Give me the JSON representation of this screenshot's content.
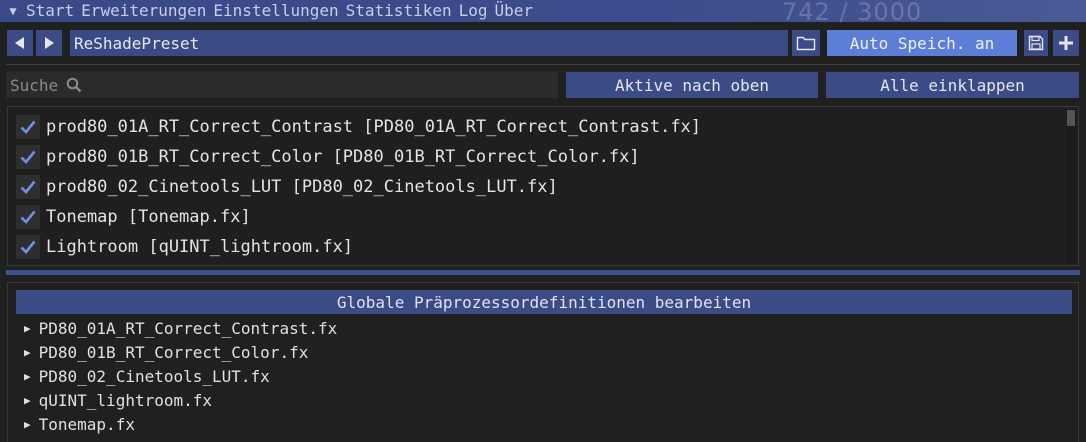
{
  "menubar": {
    "toggle_icon": "caret-down",
    "items": [
      "Start",
      "Erweiterungen",
      "Einstellungen",
      "Statistiken",
      "Log",
      "Über"
    ],
    "counter": "742 / 3000"
  },
  "preset": {
    "prev_icon": "arrow-left",
    "next_icon": "arrow-right",
    "name": "ReShadePreset",
    "folder_icon": "folder",
    "auto_save_label": "Auto Speich. an",
    "save_icon": "floppy-disk",
    "add_icon": "plus"
  },
  "search": {
    "placeholder": "Suche",
    "icon": "magnifier"
  },
  "actions": {
    "active_top_label": "Aktive nach oben",
    "collapse_all_label": "Alle einklappen"
  },
  "effects": [
    {
      "label": "prod80_01A_RT_Correct_Contrast [PD80_01A_RT_Correct_Contrast.fx]",
      "checked": true
    },
    {
      "label": "prod80_01B_RT_Correct_Color [PD80_01B_RT_Correct_Color.fx]",
      "checked": true
    },
    {
      "label": "prod80_02_Cinetools_LUT [PD80_02_Cinetools_LUT.fx]",
      "checked": true
    },
    {
      "label": "Tonemap [Tonemap.fx]",
      "checked": true
    },
    {
      "label": "Lightroom [qUINT_lightroom.fx]",
      "checked": true
    }
  ],
  "lower": {
    "header": "Globale Präprozessordefinitionen bearbeiten",
    "files": [
      "PD80_01A_RT_Correct_Contrast.fx",
      "PD80_01B_RT_Correct_Color.fx",
      "PD80_02_Cinetools_LUT.fx",
      "qUINT_lightroom.fx",
      "Tonemap.fx"
    ]
  },
  "colors": {
    "accent": "#3b4b85",
    "accent_light": "#5d7ed6",
    "check": "#6f90e8",
    "background": "#202020"
  }
}
